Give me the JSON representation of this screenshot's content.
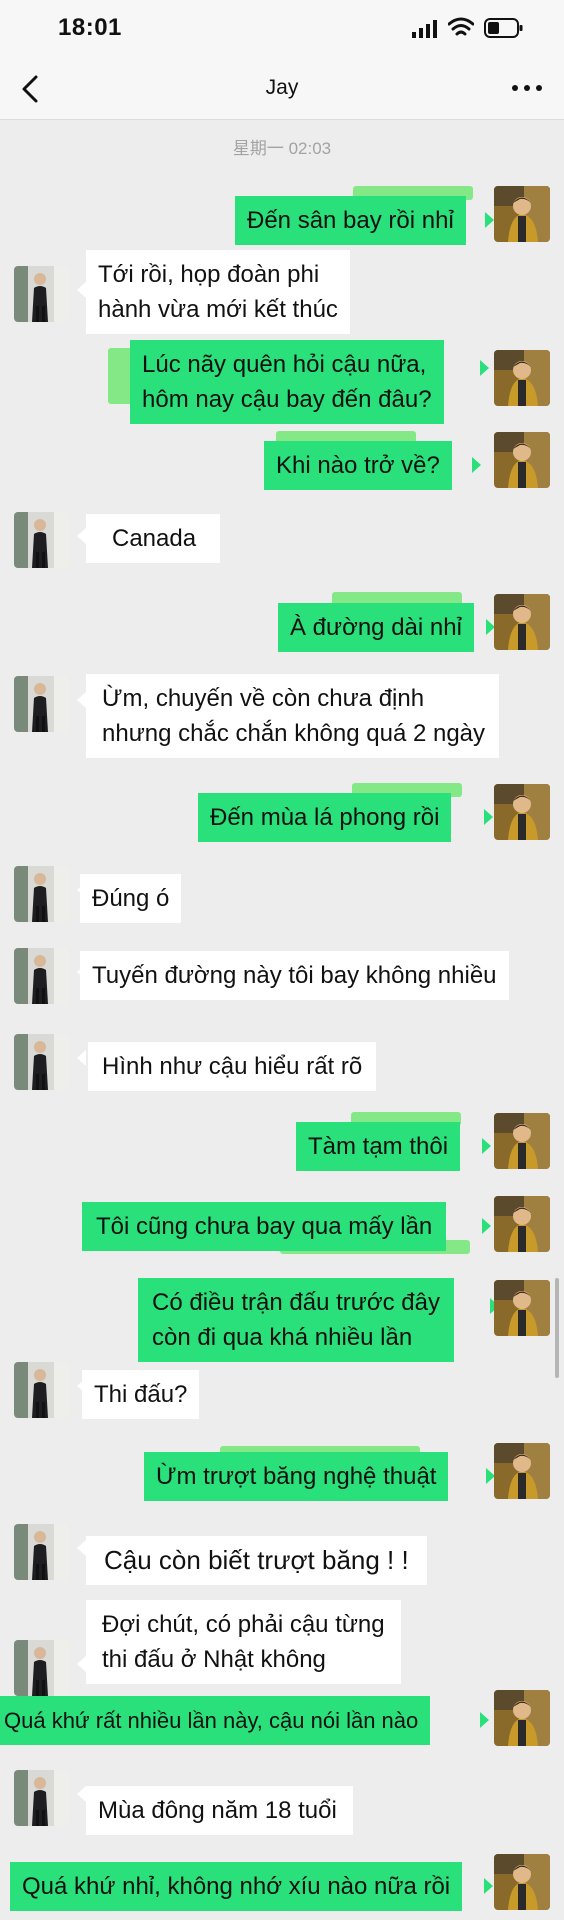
{
  "status_bar": {
    "time": "18:01"
  },
  "header": {
    "title": "Jay"
  },
  "chat": {
    "timestamp": "星期一 02:03"
  },
  "messages": [
    {
      "text": "Đến sân bay rồi nhỉ"
    },
    {
      "lines": [
        "Tới rồi, họp đoàn phi",
        "hành vừa mới kết thúc"
      ]
    },
    {
      "lines": [
        "Lúc nãy quên hỏi cậu nữa,",
        "hôm nay cậu bay đến đâu?"
      ]
    },
    {
      "text": "Khi nào trở về?"
    },
    {
      "text": "Canada"
    },
    {
      "text": "À đường dài nhỉ"
    },
    {
      "lines": [
        "Ừm, chuyến về còn chưa định",
        "nhưng chắc chắn không quá 2 ngày"
      ]
    },
    {
      "text": "Đến mùa lá phong rồi"
    },
    {
      "text": "Đúng ó"
    },
    {
      "text": "Tuyến đường này tôi bay không nhiều"
    },
    {
      "text": "Hình như cậu hiểu rất rõ"
    },
    {
      "text": "Tàm tạm thôi"
    },
    {
      "text": "Tôi cũng chưa bay qua mấy lần"
    },
    {
      "lines": [
        "Có điều trận đấu trước đây",
        "còn đi qua khá nhiều lần"
      ]
    },
    {
      "text": "Thi đấu?"
    },
    {
      "text": "Ừm trượt băng nghệ thuật"
    },
    {
      "text": "Cậu còn biết trượt băng ! !"
    },
    {
      "lines": [
        "Đợi chút, có phải cậu từng",
        "thi đấu ở Nhật không"
      ]
    },
    {
      "text": "Quá khứ rất nhiều lần này, cậu nói lần nào"
    },
    {
      "text": "Mùa đông năm 18 tuổi"
    },
    {
      "text": "Quá khứ nhỉ, không nhớ xíu nào nữa rồi"
    }
  ],
  "colors": {
    "outgoing_bubble": "#29e07a",
    "incoming_bubble": "#ffffff",
    "background": "#ededed",
    "highlight": "#84e887"
  }
}
